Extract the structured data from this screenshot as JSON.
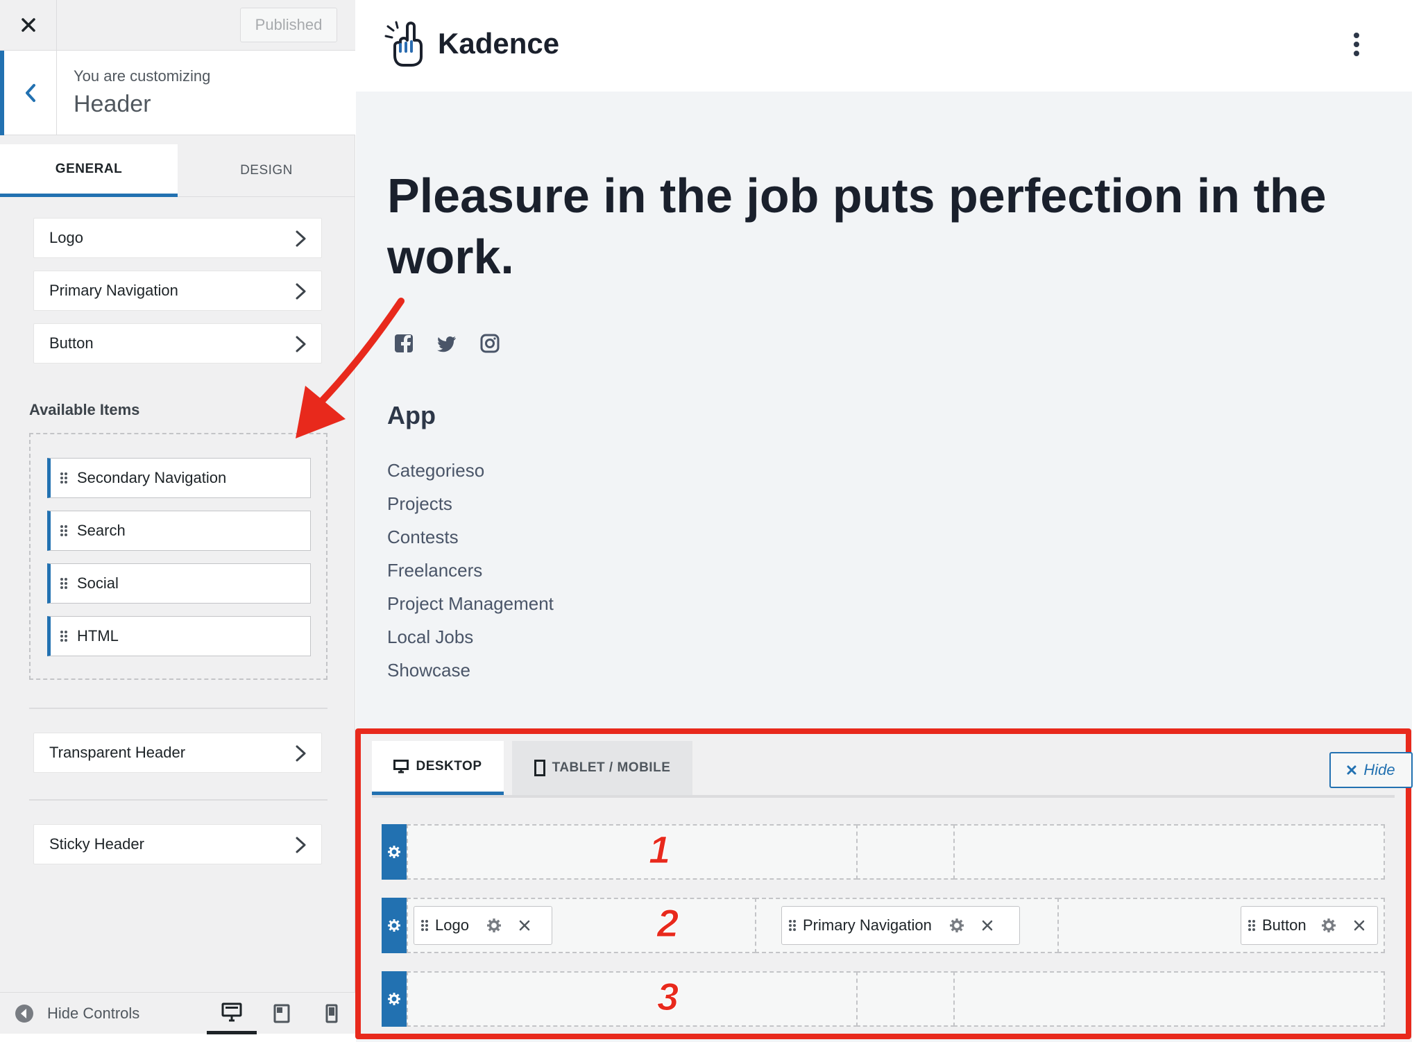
{
  "sidebar": {
    "published_label": "Published",
    "customizing_label": "You are customizing",
    "section_title": "Header",
    "tabs": [
      {
        "label": "GENERAL",
        "active": true
      },
      {
        "label": "DESIGN",
        "active": false
      }
    ],
    "links": [
      {
        "label": "Logo"
      },
      {
        "label": "Primary Navigation"
      },
      {
        "label": "Button"
      }
    ],
    "available_heading": "Available Items",
    "available_items": [
      {
        "label": "Secondary Navigation"
      },
      {
        "label": "Search"
      },
      {
        "label": "Social"
      },
      {
        "label": "HTML"
      }
    ],
    "transparent_header": "Transparent Header",
    "sticky_header": "Sticky Header",
    "footer": {
      "hide_controls": "Hide Controls",
      "active_device": "desktop"
    }
  },
  "preview": {
    "brand_name": "Kadence",
    "hero_text": "Pleasure in the job puts perfection in the work.",
    "social_icons": [
      "facebook-icon",
      "twitter-icon",
      "instagram-icon"
    ],
    "app_heading": "App",
    "app_links": [
      "Categorieso",
      "Projects",
      "Contests",
      "Freelancers",
      "Project Management",
      "Local Jobs",
      "Showcase"
    ]
  },
  "builder": {
    "tabs": [
      {
        "label": "DESKTOP",
        "icon": "desktop-icon",
        "active": true
      },
      {
        "label": "TABLET / MOBILE",
        "icon": "mobile-icon",
        "active": false
      }
    ],
    "hide_label": "Hide",
    "rows": [
      {
        "number": "1",
        "items": []
      },
      {
        "number": "2",
        "items": [
          {
            "label": "Logo",
            "zone": "left"
          },
          {
            "label": "Primary Navigation",
            "zone": "center"
          },
          {
            "label": "Button",
            "zone": "right"
          }
        ]
      },
      {
        "number": "3",
        "items": []
      }
    ]
  },
  "colors": {
    "accent": "#2271b1",
    "annotation": "#e8291c",
    "heading": "#1a202c"
  }
}
